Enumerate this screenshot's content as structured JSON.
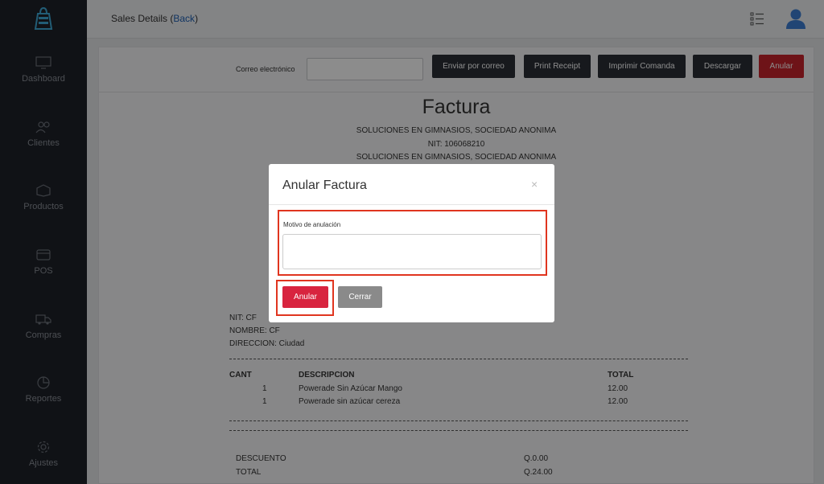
{
  "sidebar": {
    "items": [
      {
        "label": "Dashboard",
        "icon": "monitor-icon"
      },
      {
        "label": "Clientes",
        "icon": "users-icon"
      },
      {
        "label": "Productos",
        "icon": "box-icon"
      },
      {
        "label": "POS",
        "icon": "card-icon"
      },
      {
        "label": "Compras",
        "icon": "truck-icon"
      },
      {
        "label": "Reportes",
        "icon": "pie-icon"
      },
      {
        "label": "Ajustes",
        "icon": "gear-icon"
      }
    ]
  },
  "header": {
    "title_prefix": "Sales Details (",
    "back_label": "Back",
    "title_suffix": ")"
  },
  "toolbar": {
    "email_label": "Correo electrónico",
    "email_value": "",
    "buttons": [
      "Enviar por correo",
      "Print Receipt",
      "Imprimir Comanda",
      "Descargar",
      "Anular"
    ]
  },
  "invoice": {
    "title": "Factura",
    "company_name": "SOLUCIONES EN GIMNASIOS, SOCIEDAD ANONIMA",
    "nit": "NIT: 106068210",
    "company_name_2": "SOLUCIONES EN GIMNASIOS, SOCIEDAD ANONIMA",
    "customer": {
      "nit": "NIT: CF",
      "nombre": "NOMBRE: CF",
      "direccion": "DIRECCION: Ciudad"
    },
    "columns": {
      "cant": "CANT",
      "descripcion": "DESCRIPCION",
      "total": "TOTAL"
    },
    "rows": [
      {
        "cant": "1",
        "descripcion": "Powerade Sin Azúcar Mango",
        "total": "12.00"
      },
      {
        "cant": "1",
        "descripcion": "Powerade sin azúcar cereza",
        "total": "12.00"
      }
    ],
    "summary": [
      {
        "label": "DESCUENTO",
        "value": "Q.0.00"
      },
      {
        "label": "TOTAL",
        "value": "Q.24.00"
      }
    ]
  },
  "modal": {
    "title": "Anular Factura",
    "close_symbol": "×",
    "field_label": "Motivo de anulación",
    "field_value": "",
    "confirm_label": "Anular",
    "cancel_label": "Cerrar"
  },
  "colors": {
    "sidebar_bg": "#1e2229",
    "accent_red": "#d8243f",
    "highlight": "#e0351f",
    "link_blue": "#1e5fb3"
  }
}
